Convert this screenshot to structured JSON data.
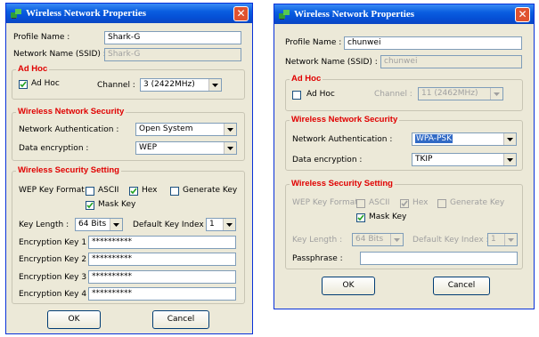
{
  "dialog1": {
    "title": "Wireless Network Properties",
    "close": "✕",
    "profile_name_label": "Profile Name :",
    "profile_name_value": "Shark-G",
    "ssid_label": "Network Name (SSID) :",
    "ssid_value": "Shark-G",
    "adhoc_group": "Ad Hoc",
    "adhoc_label": "Ad Hoc",
    "adhoc_checked": true,
    "channel_label": "Channel :",
    "channel_value": "3  (2422MHz)",
    "security_group": "Wireless Network Security",
    "auth_label": "Network Authentication :",
    "auth_value": "Open System",
    "encryption_label": "Data encryption :",
    "encryption_value": "WEP",
    "setting_group": "Wireless Security Setting",
    "wep_format_label": "WEP Key Format :",
    "ascii_label": "ASCII",
    "hex_label": "Hex",
    "generate_key_label": "Generate Key",
    "mask_key_label": "Mask Key",
    "key_length_label": "Key Length :",
    "key_length_value": "64 Bits",
    "default_key_index_label": "Default Key Index :",
    "default_key_index_value": "1",
    "enc_key1_label": "Encryption Key 1 :",
    "enc_key1_value": "**********",
    "enc_key2_label": "Encryption Key 2 :",
    "enc_key2_value": "**********",
    "enc_key3_label": "Encryption Key 3 :",
    "enc_key3_value": "**********",
    "enc_key4_label": "Encryption Key 4 :",
    "enc_key4_value": "**********",
    "ok_label": "OK",
    "cancel_label": "Cancel"
  },
  "dialog2": {
    "title": "Wireless Network Properties",
    "close": "✕",
    "profile_name_label": "Profile Name :",
    "profile_name_value": "chunwei",
    "ssid_label": "Network Name (SSID) :",
    "ssid_value": "chunwei",
    "adhoc_group": "Ad Hoc",
    "adhoc_label": "Ad Hoc",
    "adhoc_checked": false,
    "channel_label": "Channel :",
    "channel_value": "11 (2462MHz)",
    "security_group": "Wireless Network Security",
    "auth_label": "Network Authentication :",
    "auth_value": "WPA-PSK",
    "encryption_label": "Data encryption :",
    "encryption_value": "TKIP",
    "setting_group": "Wireless Security Setting",
    "wep_format_label": "WEP Key Format :",
    "ascii_label": "ASCII",
    "hex_label": "Hex",
    "generate_key_label": "Generate Key",
    "mask_key_label": "Mask Key",
    "key_length_label": "Key Length :",
    "key_length_value": "64 Bits",
    "default_key_index_label": "Default Key Index :",
    "default_key_index_value": "1",
    "passphrase_label": "Passphrase :",
    "passphrase_value": "",
    "ok_label": "OK",
    "cancel_label": "Cancel"
  }
}
